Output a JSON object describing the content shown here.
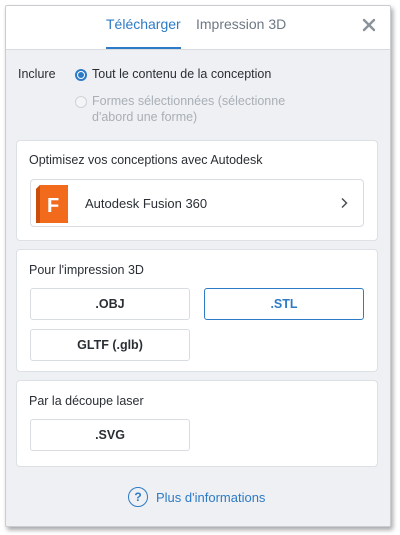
{
  "tabs": [
    {
      "label": "Télécharger",
      "active": true
    },
    {
      "label": "Impression 3D",
      "active": false
    }
  ],
  "include": {
    "label": "Inclure",
    "options": [
      {
        "label": "Tout le contenu de la conception",
        "checked": true,
        "disabled": false
      },
      {
        "label_line1": "Formes sélectionnées (sélectionne",
        "label_line2": "d'abord une forme)",
        "checked": false,
        "disabled": true
      }
    ]
  },
  "optimize": {
    "title": "Optimisez vos conceptions avec Autodesk",
    "fusion_label": "Autodesk Fusion 360",
    "fusion_letter": "F"
  },
  "print3d": {
    "title": "Pour l'impression 3D",
    "formats": [
      ".OBJ",
      ".STL",
      "GLTF (.glb)"
    ],
    "selected": ".STL"
  },
  "laser": {
    "title": "Par la découpe laser",
    "formats": [
      ".SVG"
    ]
  },
  "help": {
    "icon_glyph": "?",
    "label": "Plus d'informations"
  },
  "colors": {
    "accent": "#2d7ac6",
    "fusion_orange": "#f26b1d"
  }
}
